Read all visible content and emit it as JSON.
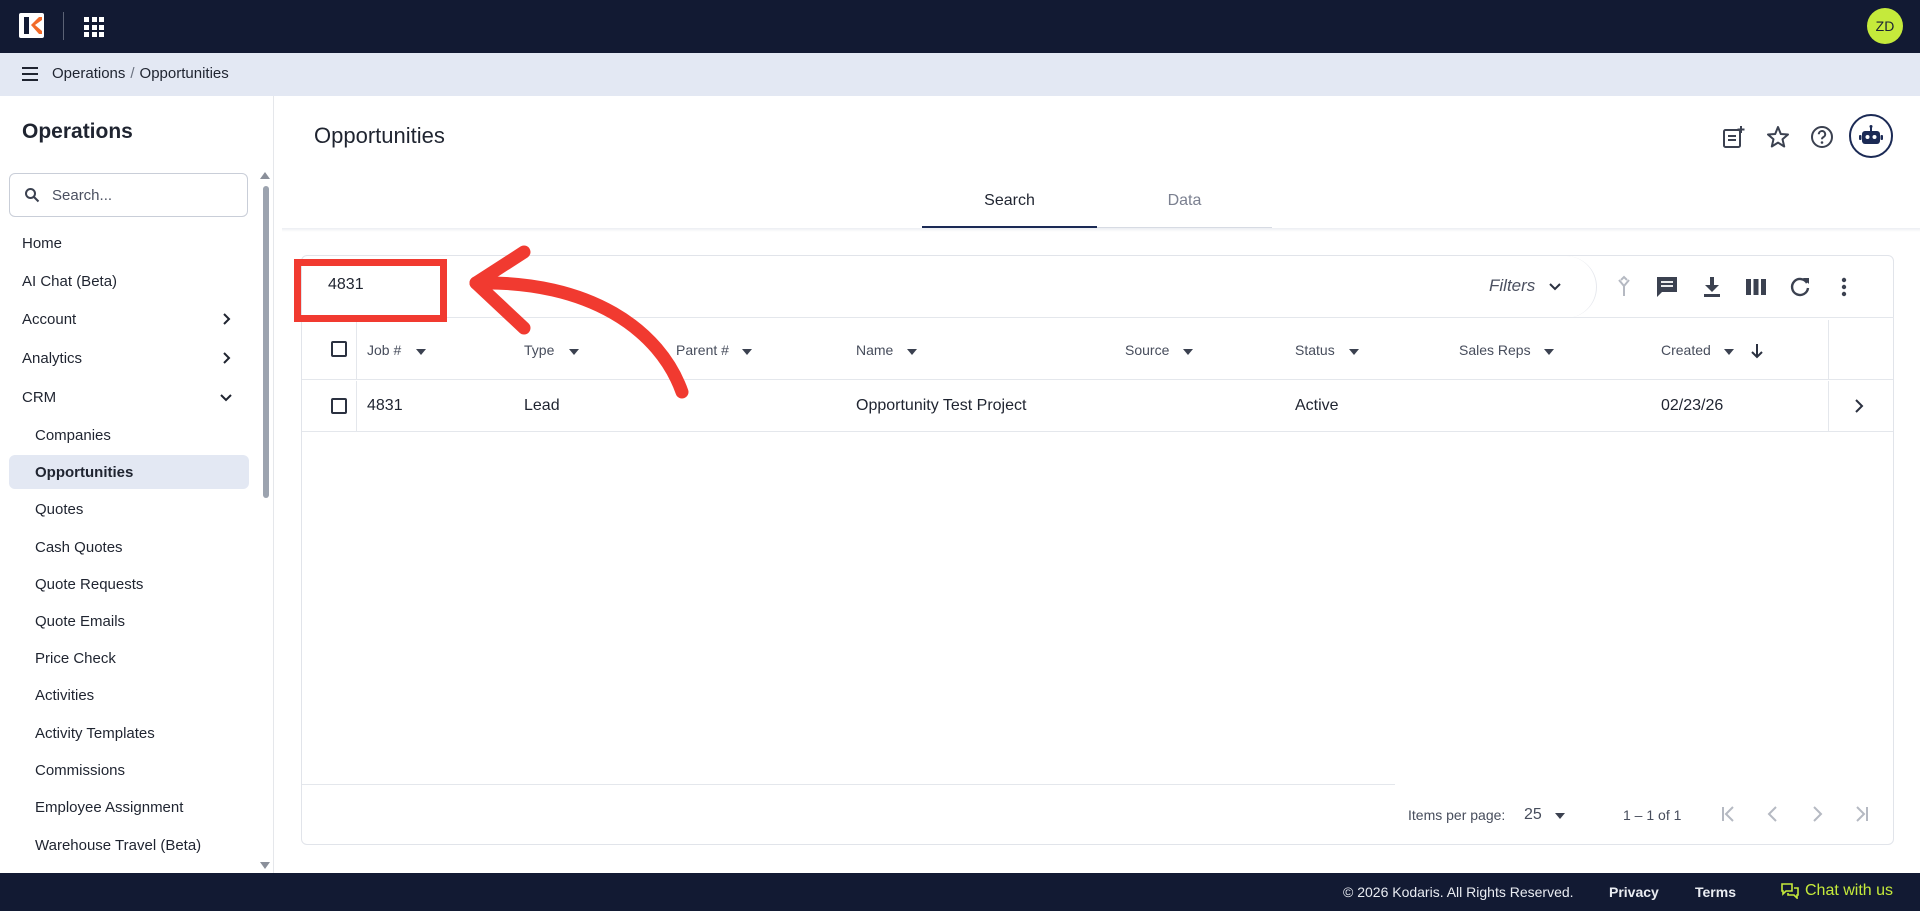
{
  "app": {
    "user_initials": "ZD",
    "brand_color": "#121a33",
    "accent_color": "#c5ea3b"
  },
  "breadcrumb": {
    "section": "Operations",
    "separator": "/",
    "page": "Opportunities"
  },
  "sidebar": {
    "title": "Operations",
    "search_placeholder": "Search...",
    "items": [
      {
        "label": "Home"
      },
      {
        "label": "AI Chat (Beta)"
      },
      {
        "label": "Account",
        "chevron": "right"
      },
      {
        "label": "Analytics",
        "chevron": "right"
      },
      {
        "label": "CRM",
        "chevron": "down"
      },
      {
        "label": "Companies"
      },
      {
        "label": "Opportunities",
        "active": true
      },
      {
        "label": "Quotes"
      },
      {
        "label": "Cash Quotes"
      },
      {
        "label": "Quote Requests"
      },
      {
        "label": "Quote Emails"
      },
      {
        "label": "Price Check"
      },
      {
        "label": "Activities"
      },
      {
        "label": "Activity Templates"
      },
      {
        "label": "Commissions"
      },
      {
        "label": "Employee Assignment"
      },
      {
        "label": "Warehouse Travel (Beta)"
      }
    ]
  },
  "main": {
    "title": "Opportunities",
    "tabs": [
      {
        "label": "Search",
        "active": true
      },
      {
        "label": "Data"
      }
    ],
    "search_value": "4831",
    "filters_label": "Filters",
    "table": {
      "columns": [
        "Job #",
        "Type",
        "Parent #",
        "Name",
        "Source",
        "Status",
        "Sales Reps",
        "Created"
      ],
      "rows": [
        {
          "job": "4831",
          "type": "Lead",
          "parent": "",
          "name": "Opportunity Test Project",
          "source": "",
          "status": "Active",
          "sales_reps": "",
          "created": "02/23/26"
        }
      ]
    },
    "paginator": {
      "items_per_page_label": "Items per page:",
      "page_size": "25",
      "range": "1 – 1 of 1"
    }
  },
  "footer": {
    "copyright": "© 2026 Kodaris. All Rights Reserved.",
    "privacy": "Privacy",
    "terms": "Terms",
    "chat": "Chat with us"
  },
  "annotation": {
    "box_color": "#f13a30"
  }
}
